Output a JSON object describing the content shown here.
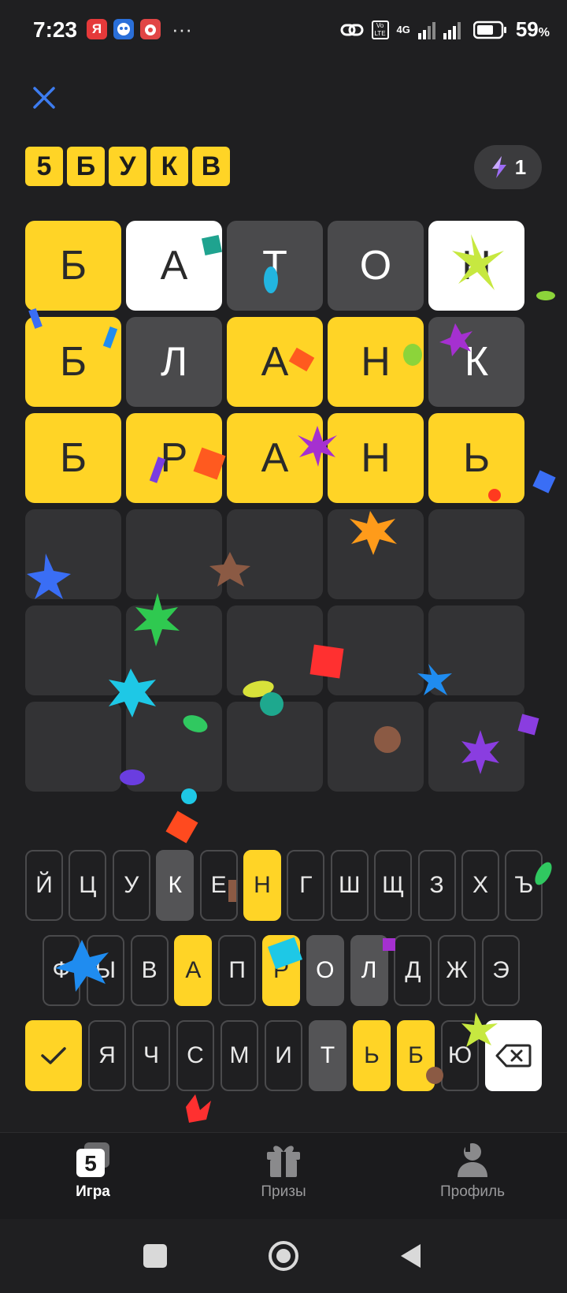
{
  "status_bar": {
    "time": "7:23",
    "app_icons": [
      "yandex-icon",
      "bot-app-icon",
      "game-app-icon"
    ],
    "more": "···",
    "network": "4G",
    "volte": "Vo LTE",
    "battery_percent": "59",
    "battery_unit": "%"
  },
  "header": {
    "title_letters": [
      "5",
      "Б",
      "У",
      "К",
      "В"
    ],
    "hint_count": "1"
  },
  "board": {
    "rows": [
      [
        {
          "letter": "Б",
          "state": "hit"
        },
        {
          "letter": "А",
          "state": "white"
        },
        {
          "letter": "Т",
          "state": "miss"
        },
        {
          "letter": "О",
          "state": "miss"
        },
        {
          "letter": "Н",
          "state": "white"
        }
      ],
      [
        {
          "letter": "Б",
          "state": "hit"
        },
        {
          "letter": "Л",
          "state": "miss"
        },
        {
          "letter": "А",
          "state": "hit"
        },
        {
          "letter": "Н",
          "state": "hit"
        },
        {
          "letter": "К",
          "state": "miss"
        }
      ],
      [
        {
          "letter": "Б",
          "state": "hit"
        },
        {
          "letter": "Р",
          "state": "hit"
        },
        {
          "letter": "А",
          "state": "hit"
        },
        {
          "letter": "Н",
          "state": "hit"
        },
        {
          "letter": "Ь",
          "state": "hit"
        }
      ],
      [
        {
          "letter": "",
          "state": "empty"
        },
        {
          "letter": "",
          "state": "empty"
        },
        {
          "letter": "",
          "state": "empty"
        },
        {
          "letter": "",
          "state": "empty"
        },
        {
          "letter": "",
          "state": "empty"
        }
      ],
      [
        {
          "letter": "",
          "state": "empty"
        },
        {
          "letter": "",
          "state": "empty"
        },
        {
          "letter": "",
          "state": "empty"
        },
        {
          "letter": "",
          "state": "empty"
        },
        {
          "letter": "",
          "state": "empty"
        }
      ],
      [
        {
          "letter": "",
          "state": "empty"
        },
        {
          "letter": "",
          "state": "empty"
        },
        {
          "letter": "",
          "state": "empty"
        },
        {
          "letter": "",
          "state": "empty"
        },
        {
          "letter": "",
          "state": "empty"
        }
      ]
    ]
  },
  "keyboard": {
    "row1": [
      {
        "label": "Й",
        "state": "none"
      },
      {
        "label": "Ц",
        "state": "none"
      },
      {
        "label": "У",
        "state": "none"
      },
      {
        "label": "К",
        "state": "miss"
      },
      {
        "label": "Е",
        "state": "none"
      },
      {
        "label": "Н",
        "state": "hit"
      },
      {
        "label": "Г",
        "state": "none"
      },
      {
        "label": "Ш",
        "state": "none"
      },
      {
        "label": "Щ",
        "state": "none"
      },
      {
        "label": "З",
        "state": "none"
      },
      {
        "label": "Х",
        "state": "none"
      },
      {
        "label": "Ъ",
        "state": "none"
      }
    ],
    "row2": [
      {
        "label": "Ф",
        "state": "none"
      },
      {
        "label": "Ы",
        "state": "none"
      },
      {
        "label": "В",
        "state": "none"
      },
      {
        "label": "А",
        "state": "hit"
      },
      {
        "label": "П",
        "state": "none"
      },
      {
        "label": "Р",
        "state": "hit"
      },
      {
        "label": "О",
        "state": "miss"
      },
      {
        "label": "Л",
        "state": "miss"
      },
      {
        "label": "Д",
        "state": "none"
      },
      {
        "label": "Ж",
        "state": "none"
      },
      {
        "label": "Э",
        "state": "none"
      }
    ],
    "row3": [
      {
        "label": "Я",
        "state": "none"
      },
      {
        "label": "Ч",
        "state": "none"
      },
      {
        "label": "С",
        "state": "none"
      },
      {
        "label": "М",
        "state": "none"
      },
      {
        "label": "И",
        "state": "none"
      },
      {
        "label": "Т",
        "state": "miss"
      },
      {
        "label": "Ь",
        "state": "hit"
      },
      {
        "label": "Б",
        "state": "hit"
      },
      {
        "label": "Ю",
        "state": "none"
      }
    ],
    "enter_icon": "checkmark-icon",
    "delete_icon": "backspace-icon"
  },
  "bottom_nav": {
    "items": [
      {
        "label": "Игра",
        "icon": "game-5-icon",
        "active": true
      },
      {
        "label": "Призы",
        "icon": "gift-icon",
        "active": false
      },
      {
        "label": "Профиль",
        "icon": "profile-icon",
        "active": false
      }
    ]
  },
  "system_nav": [
    "square-recents-icon",
    "circle-home-icon",
    "triangle-back-icon"
  ],
  "colors": {
    "background": "#1f1f21",
    "hit": "#ffd426",
    "miss": "#4a4a4c",
    "empty": "#333335",
    "accent_blue": "#3d7cf0"
  }
}
